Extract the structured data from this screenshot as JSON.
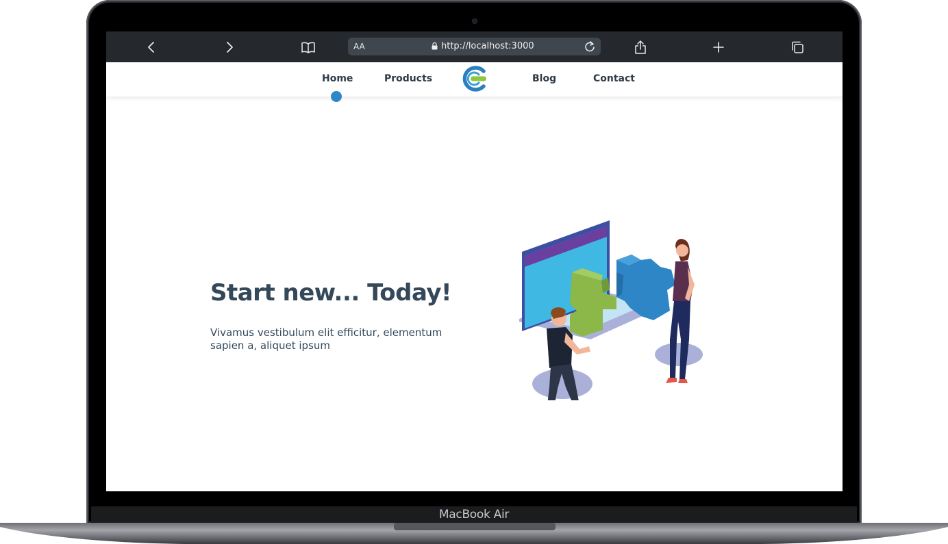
{
  "device": {
    "label": "MacBook Air"
  },
  "browser": {
    "reader_mode_label": "AA",
    "url": "http://localhost:3000",
    "icons": [
      "back-icon",
      "forward-icon",
      "bookmarks-icon",
      "lock-icon",
      "reload-icon",
      "share-icon",
      "new-tab-icon",
      "tabs-icon"
    ]
  },
  "nav": {
    "items": [
      {
        "label": "Home",
        "active": true
      },
      {
        "label": "Products",
        "active": false
      },
      {
        "label": "Blog",
        "active": false
      },
      {
        "label": "Contact",
        "active": false
      }
    ],
    "active_indicator_color": "#2e88c7"
  },
  "hero": {
    "title": "Start new... Today!",
    "text": "Vivamus vestibulum elit efficitur, elementum sapien a, aliquet ipsum"
  },
  "colors": {
    "text": "#34485a",
    "accent_blue": "#2e88c7",
    "accent_green": "#7cb342",
    "toolbar": "#25292e"
  }
}
